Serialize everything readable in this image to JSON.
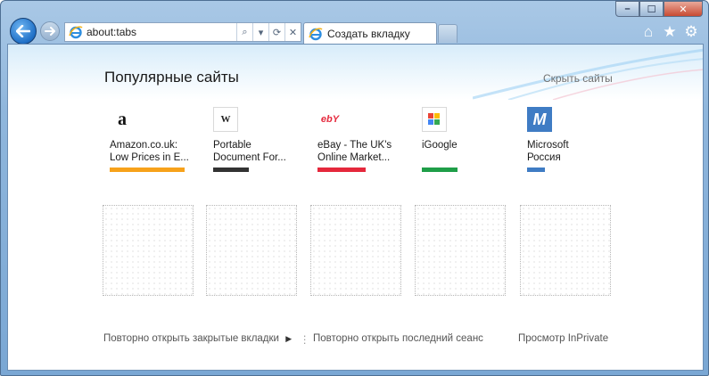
{
  "browser": {
    "address_url": "about:tabs",
    "tab_title": "Создать вкладку"
  },
  "page": {
    "title": "Популярные сайты",
    "hide_sites": "Скрыть сайты",
    "sites": [
      {
        "name": "Amazon.co.uk:\nLow Prices in E...",
        "logo": "a",
        "color": "#f7a21b"
      },
      {
        "name": "Portable\nDocument For...",
        "logo": "W",
        "color": "#333333"
      },
      {
        "name": "eBay - The UK's\nOnline Market...",
        "logo": "ebY",
        "color": "#e5283c"
      },
      {
        "name": "iGoogle",
        "logo": "g",
        "color": "#1f9e48"
      },
      {
        "name": "Microsoft\nРоссия",
        "logo": "M",
        "color": "#3f7cc4"
      }
    ],
    "footer": {
      "reopen_closed_tabs": "Повторно открыть закрытые вкладки",
      "reopen_last_session": "Повторно открыть последний сеанс",
      "inprivate": "Просмотр InPrivate"
    }
  },
  "colors": {
    "accent": "#1f6fc6"
  }
}
